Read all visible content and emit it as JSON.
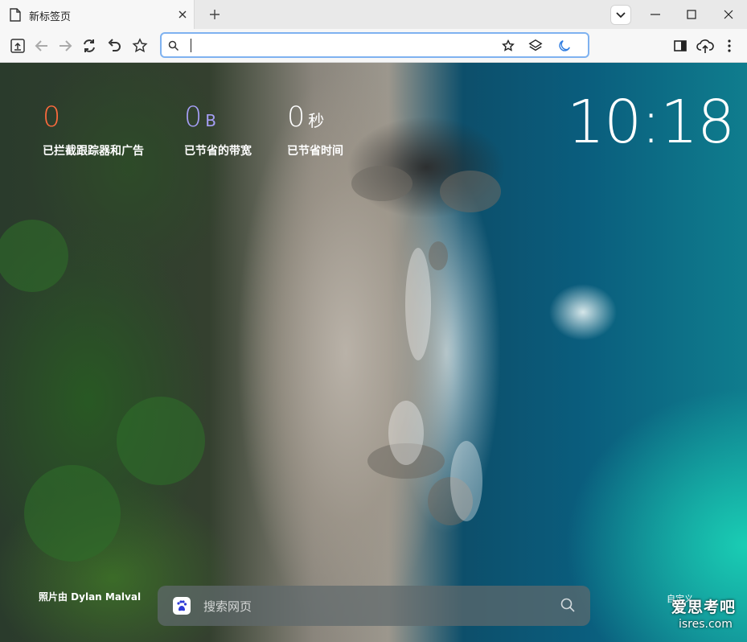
{
  "tab": {
    "title": "新标签页"
  },
  "omnibox": {
    "value": "",
    "placeholder": ""
  },
  "stats": [
    {
      "value": "0",
      "unit": "",
      "caption": "已拦截跟踪器和广告",
      "color": "#ff6a3d"
    },
    {
      "value": "0",
      "unit": "B",
      "caption": "已节省的带宽",
      "color": "#a59ef5"
    },
    {
      "value": "0",
      "unit": "秒",
      "caption": "已节省时间",
      "color": "#ffffff"
    }
  ],
  "clock": "10:18",
  "photo_credit": "照片由 Dylan Malval",
  "search": {
    "placeholder": "搜索网页"
  },
  "customize": "自定义",
  "watermark": {
    "line1": "爱思考吧",
    "line2": "isres.com"
  },
  "icons": {
    "tab": [
      "page-icon",
      "close-icon",
      "plus-icon",
      "chevron-down-icon",
      "minimize-icon",
      "maximize-icon",
      "close-window-icon"
    ],
    "toolbar": [
      "upload-page-icon",
      "back-arrow-icon",
      "forward-arrow-icon",
      "reload-icon",
      "undo-icon",
      "bookmark-star-icon",
      "search-icon",
      "star-icon",
      "layers-icon",
      "moon-icon",
      "sidebar-icon",
      "cloud-upload-icon",
      "more-vertical-icon"
    ]
  }
}
